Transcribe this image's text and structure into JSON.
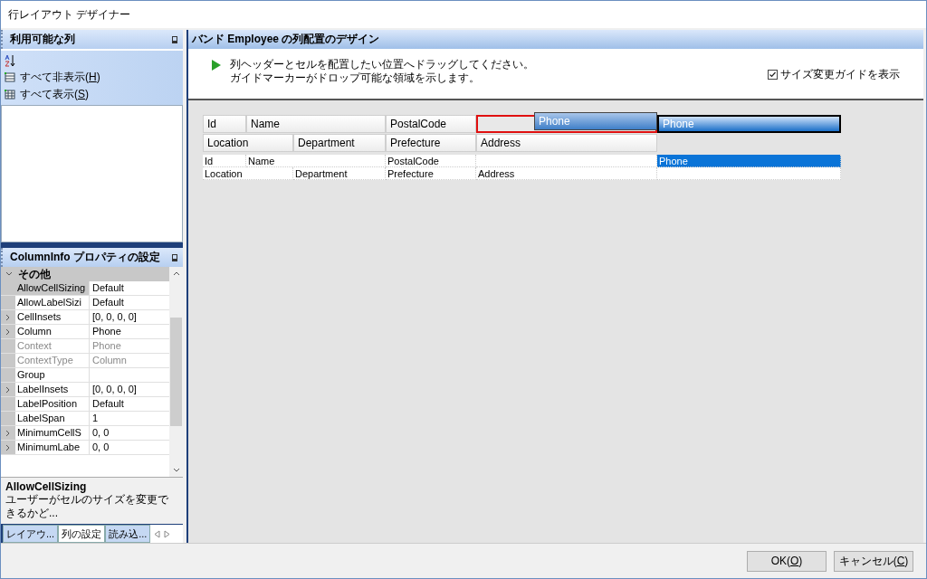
{
  "window": {
    "title": "行レイアウト デザイナー"
  },
  "columns_panel": {
    "title": "利用可能な列",
    "actions": [
      {
        "kind": "sort"
      },
      {
        "kind": "hide_all",
        "label_before": "すべて非表示(",
        "accelerator": "H",
        "label_after": ")"
      },
      {
        "kind": "show_all",
        "label_before": "すべて表示(",
        "accelerator": "S",
        "label_after": ")"
      }
    ]
  },
  "properties_panel": {
    "title": "ColumnInfo プロパティの設定",
    "category": {
      "label": "その他",
      "expanded": true
    },
    "rows": [
      {
        "name": "AllowCellSizing",
        "value": "Default",
        "expandable": false,
        "disabled": false,
        "selected": true
      },
      {
        "name": "AllowLabelSizi",
        "value": "Default",
        "expandable": false,
        "disabled": false,
        "selected": false
      },
      {
        "name": "CellInsets",
        "value": "[0, 0, 0, 0]",
        "expandable": true,
        "disabled": false,
        "selected": false
      },
      {
        "name": "Column",
        "value": "Phone",
        "expandable": true,
        "disabled": false,
        "selected": false
      },
      {
        "name": "Context",
        "value": "Phone",
        "expandable": false,
        "disabled": true,
        "selected": false
      },
      {
        "name": "ContextType",
        "value": "Column",
        "expandable": false,
        "disabled": true,
        "selected": false
      },
      {
        "name": "Group",
        "value": "",
        "expandable": false,
        "disabled": false,
        "selected": false
      },
      {
        "name": "LabelInsets",
        "value": "[0, 0, 0, 0]",
        "expandable": true,
        "disabled": false,
        "selected": false
      },
      {
        "name": "LabelPosition",
        "value": "Default",
        "expandable": false,
        "disabled": false,
        "selected": false
      },
      {
        "name": "LabelSpan",
        "value": "1",
        "expandable": false,
        "disabled": false,
        "selected": false
      },
      {
        "name": "MinimumCellS",
        "value": "0, 0",
        "expandable": true,
        "disabled": false,
        "selected": false
      },
      {
        "name": "MinimumLabe",
        "value": "0, 0",
        "expandable": true,
        "disabled": false,
        "selected": false
      }
    ],
    "description": {
      "title": "AllowCellSizing",
      "text": "ユーザーがセルのサイズを変更できるかど..."
    },
    "tabs": [
      {
        "label": "レイアウ...",
        "selected": false
      },
      {
        "label": "列の設定",
        "selected": true
      },
      {
        "label": "読み込...",
        "selected": false
      }
    ]
  },
  "design_panel": {
    "title": "バンド Employee の列配置のデザイン",
    "instructions": [
      "列ヘッダーとセルを配置したい位置へドラッグしてください。",
      "ガイドマーカーがドロップ可能な領域を示します。"
    ],
    "size_guide": {
      "label": "サイズ変更ガイドを表示",
      "checked": true
    },
    "header_rows": [
      [
        {
          "text": "Id",
          "selected": false,
          "drop_target": false
        },
        {
          "text": "Name",
          "selected": false,
          "drop_target": false
        },
        {
          "text": "PostalCode",
          "selected": false,
          "drop_target": false
        },
        {
          "text": "",
          "selected": false,
          "drop_target": true
        },
        {
          "text": "Phone",
          "selected": true,
          "drop_target": false
        }
      ],
      [
        {
          "text": "Location",
          "selected": false,
          "drop_target": false
        },
        {
          "text": "Department",
          "selected": false,
          "drop_target": false
        },
        {
          "text": "Prefecture",
          "selected": false,
          "drop_target": false
        },
        {
          "text": "Address",
          "selected": false,
          "drop_target": false
        },
        {
          "kind": "blank"
        }
      ]
    ],
    "data_rows": [
      [
        {
          "text": "Id",
          "selected": false
        },
        {
          "text": "Name",
          "selected": false
        },
        {
          "text": "PostalCode",
          "selected": false
        },
        {
          "text": "",
          "selected": false
        },
        {
          "text": "Phone",
          "selected": true
        }
      ],
      [
        {
          "text": "Location",
          "selected": false
        },
        {
          "text": "Department",
          "selected": false
        },
        {
          "text": "Prefecture",
          "selected": false
        },
        {
          "text": "Address",
          "selected": false
        },
        {
          "text": "",
          "selected": false
        }
      ]
    ],
    "drag_ghost": {
      "label": "Phone"
    }
  },
  "buttons": [
    {
      "label_before": "OK(",
      "accelerator": "O",
      "label_after": ")"
    },
    {
      "label_before": "キャンセル(",
      "accelerator": "C",
      "label_after": ")"
    }
  ]
}
